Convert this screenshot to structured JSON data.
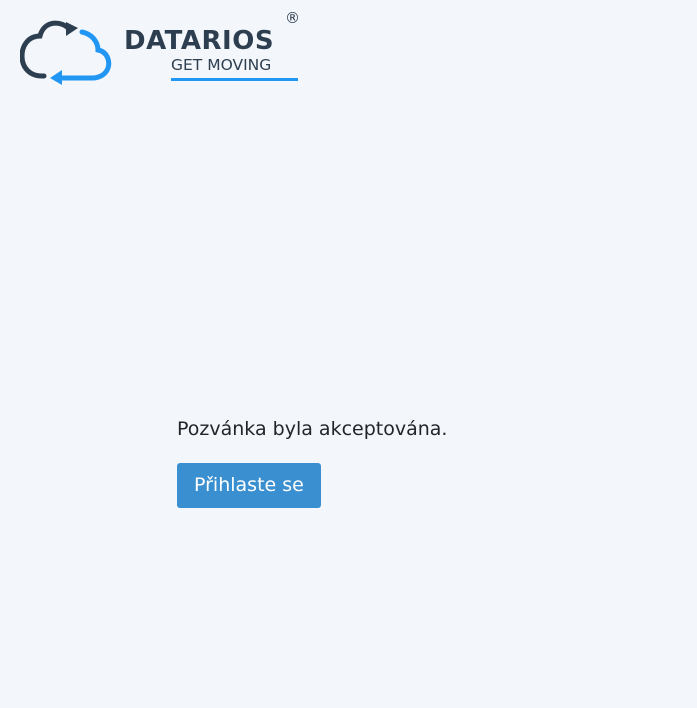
{
  "logo": {
    "name": "DATARIOS",
    "registered": "®",
    "tagline": "GET MOVING",
    "icon": "cloud-sync-icon",
    "colors": {
      "dark": "#2c3e50",
      "accent": "#2196f3"
    }
  },
  "message": "Pozvánka byla akceptována.",
  "login_button": {
    "label": "Přihlaste se",
    "color": "#3a8fd0"
  }
}
